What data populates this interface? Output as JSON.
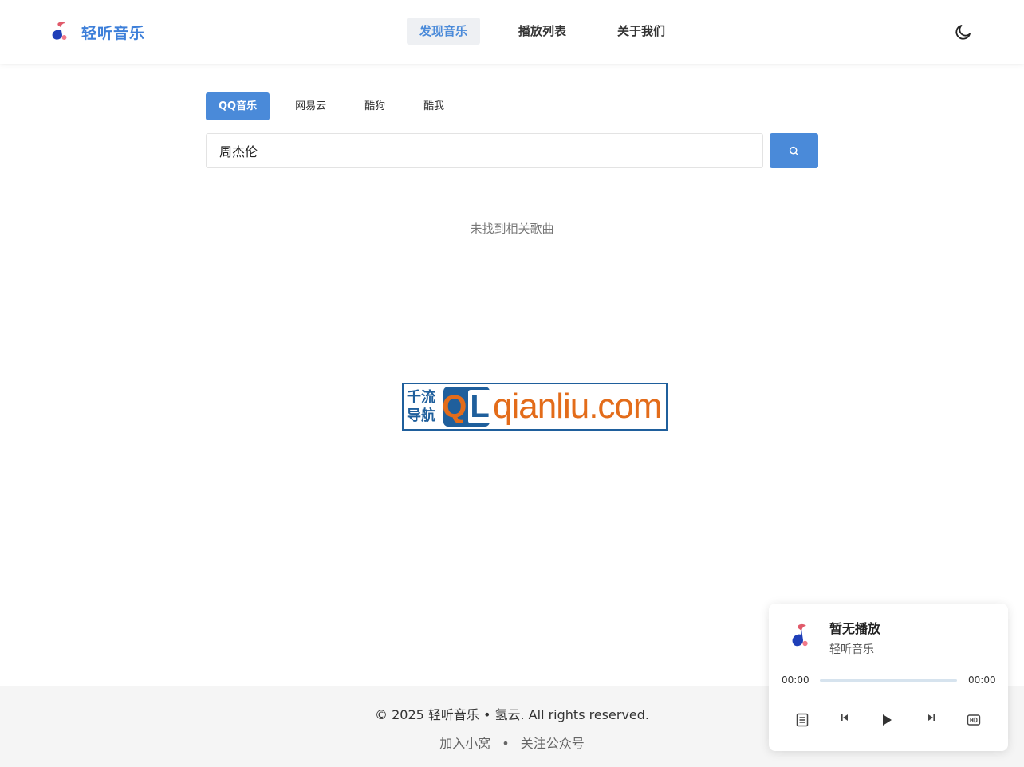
{
  "brand": {
    "name": "轻听音乐"
  },
  "nav": {
    "items": [
      {
        "label": "发现音乐",
        "active": true
      },
      {
        "label": "播放列表",
        "active": false
      },
      {
        "label": "关于我们",
        "active": false
      }
    ]
  },
  "sources": {
    "tabs": [
      {
        "label": "QQ音乐",
        "active": true
      },
      {
        "label": "网易云",
        "active": false
      },
      {
        "label": "酷狗",
        "active": false
      },
      {
        "label": "酷我",
        "active": false
      }
    ]
  },
  "search": {
    "value": "周杰伦"
  },
  "results": {
    "empty_message": "未找到相关歌曲"
  },
  "watermark": {
    "cn_line1": "千流",
    "cn_line2": "导航",
    "ql_q": "Q",
    "ql_l": "L",
    "domain": "qianliu.com"
  },
  "footer": {
    "copyright": "© 2025 轻听音乐 • 氢云. All rights reserved.",
    "link_join": "加入小窝",
    "separator": "•",
    "link_follow": "关注公众号"
  },
  "player": {
    "title": "暂无播放",
    "artist": "轻听音乐",
    "current_time": "00:00",
    "duration": "00:00",
    "progress_percent": 0
  },
  "colors": {
    "accent": "#4a8ad9",
    "brand_text": "#3d7fd9",
    "watermark_blue": "#1f5f9c",
    "watermark_orange": "#e36c1a"
  },
  "icons": {
    "theme": "moon-icon",
    "search": "search-icon",
    "playlist": "list-icon",
    "prev": "skip-previous-icon",
    "play": "play-icon",
    "next": "skip-next-icon",
    "quality": "hd-icon"
  }
}
